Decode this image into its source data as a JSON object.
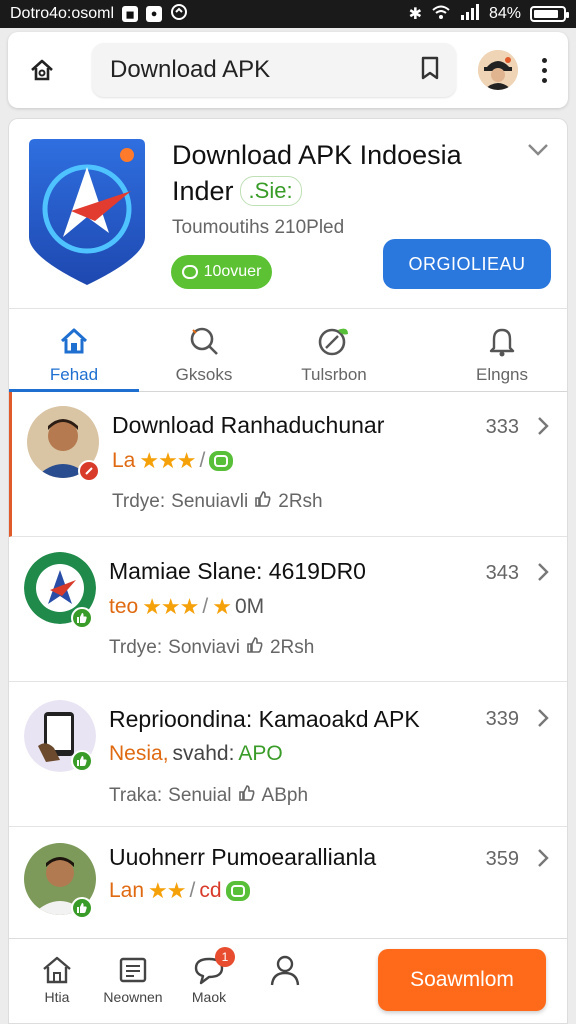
{
  "status_bar": {
    "carrier_text": "Dotro4o:osoml",
    "battery_text": "84%",
    "battery_level": 0.84
  },
  "top_bar": {
    "search_value": "Download APK"
  },
  "app": {
    "title_line1": "Download APK Indoesia",
    "title_line2": "Inder",
    "site_badge": ".Sie:",
    "subtitle": "Toumoutihs 210Pled",
    "green_pill_label": "10ovuer",
    "primary_button": "ORGIOLIEAU"
  },
  "tabs": [
    {
      "label": "Fehad",
      "icon": "home-icon",
      "active": true
    },
    {
      "label": "Gksoks",
      "icon": "search-icon",
      "active": false
    },
    {
      "label": "Tulsrbon",
      "icon": "leaf-icon",
      "active": false
    },
    {
      "label": "Elngns",
      "icon": "bell-icon",
      "active": false
    }
  ],
  "list": [
    {
      "name": "Download Ranhaduchunar",
      "prefix": "La",
      "rating": 3,
      "count": "333",
      "sub_prefix": "Trdye:",
      "sub_source": "Senuiavli",
      "sub_value": "2Rsh",
      "badge_color": "#d93b2b"
    },
    {
      "name": "Mamiae Slane: 4619DR0",
      "prefix": "teo",
      "rating": 4,
      "suffix": "0M",
      "count": "343",
      "sub_prefix": "Trdye:",
      "sub_source": "Sonviavi",
      "sub_value": "2Rsh",
      "badge_color": "#3a9c28"
    },
    {
      "name": "Reprioondina: Kamaoakd APK",
      "line2_a": "Nesia,",
      "line2_b": "svahd:",
      "line2_c": "APO",
      "count": "339",
      "sub_prefix": "Traka:",
      "sub_source": "Senuial",
      "sub_value": "ABph",
      "badge_color": "#3a9c28"
    },
    {
      "name": "Uuohnerr Pumoearallianla",
      "prefix": "Lan",
      "rating": 2,
      "suffix": "cd",
      "count": "359",
      "badge_color": "#3a9c28"
    }
  ],
  "bottom_nav": {
    "items": [
      {
        "label": "Htia",
        "icon": "home-outline-icon"
      },
      {
        "label": "Neownen",
        "icon": "news-icon"
      },
      {
        "label": "Maok",
        "icon": "chat-icon",
        "badge": "1"
      },
      {
        "label": "",
        "icon": "profile-icon"
      }
    ],
    "action_button": "Soawmlom"
  },
  "colors": {
    "accent_blue": "#2a77dd",
    "accent_orange": "#ff6a1a",
    "accent_green": "#5cc234",
    "star": "#f5a10a"
  }
}
